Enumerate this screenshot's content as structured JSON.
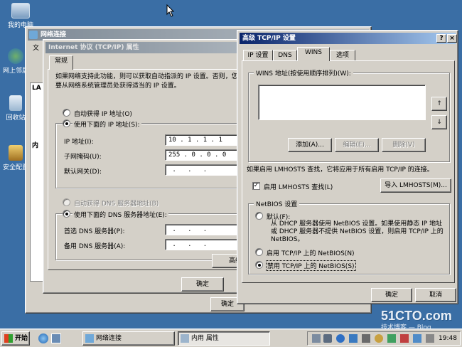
{
  "desktop": {
    "icons": [
      "我的电脑",
      "网上邻居",
      "回收站",
      "安全配置"
    ]
  },
  "net_window": {
    "title": "网络连接",
    "menu_partial": "文",
    "list_partial": "LA",
    "list_partial2": "内"
  },
  "tcpip_window": {
    "title": "Internet 协议 (TCP/IP) 属性",
    "tab": "常规",
    "description": "如果网络支持此功能，则可以获取自动指派的 IP 设置。否则，您需要从网络系统管理员处获得适当的 IP 设置。",
    "auto_ip": "自动获得 IP 地址(O)",
    "manual_ip": "使用下面的 IP 地址(S):",
    "ip_label": "IP 地址(I):",
    "ip_value": "10 . 1 . 1 . 1",
    "mask_label": "子网掩码(U):",
    "mask_value": "255 . 0 . 0 . 0",
    "gateway_label": "默认网关(D):",
    "gateway_value": " .   .   . ",
    "auto_dns": "自动获得 DNS 服务器地址(B)",
    "manual_dns": "使用下面的 DNS 服务器地址(E):",
    "dns1_label": "首选 DNS 服务器(P):",
    "dns2_label": "备用 DNS 服务器(A):",
    "dns_value": " .   .   . ",
    "advanced_btn": "高级",
    "ok_btn": "确定"
  },
  "outer_ok": "确定",
  "adv_window": {
    "title": "高级 TCP/IP 设置",
    "help_glyph": "?",
    "close_glyph": "×",
    "tabs": [
      "IP 设置",
      "DNS",
      "WINS",
      "选项"
    ],
    "wins_list_label": "WINS 地址(按使用顺序排列)(W):",
    "up_arrow": "↑",
    "down_arrow": "↓",
    "add_btn": "添加(A)...",
    "edit_btn": "编辑(E)...",
    "remove_btn": "删除(V)",
    "lmhosts_note": "如果启用 LMHOSTS 查找，它将应用于所有启用 TCP/IP 的连接。",
    "lmhosts_check": "启用 LMHOSTS 查找(L)",
    "check_mark": "✓",
    "import_btn": "导入 LMHOSTS(M)...",
    "netbios_group": "NetBIOS 设置",
    "default_opt": "默认(F):",
    "default_desc": "从 DHCP 服务器使用 NetBIOS 设置。如果使用静态 IP 地址或 DHCP 服务器不提供 NetBIOS 设置，则启用 TCP/IP 上的 NetBIOS。",
    "enable_opt": "启用 TCP/IP 上的 NetBIOS(N)",
    "disable_opt": "禁用 TCP/IP 上的 NetBIOS(S)",
    "ok_btn": "确定",
    "cancel_btn": "取消"
  },
  "taskbar": {
    "start": "开始",
    "task1": "网络连接",
    "task2": "内用 属性",
    "clock": "19:48"
  },
  "watermark": {
    "main": "51CTO.com",
    "sub": "技术博客 — Blog"
  }
}
